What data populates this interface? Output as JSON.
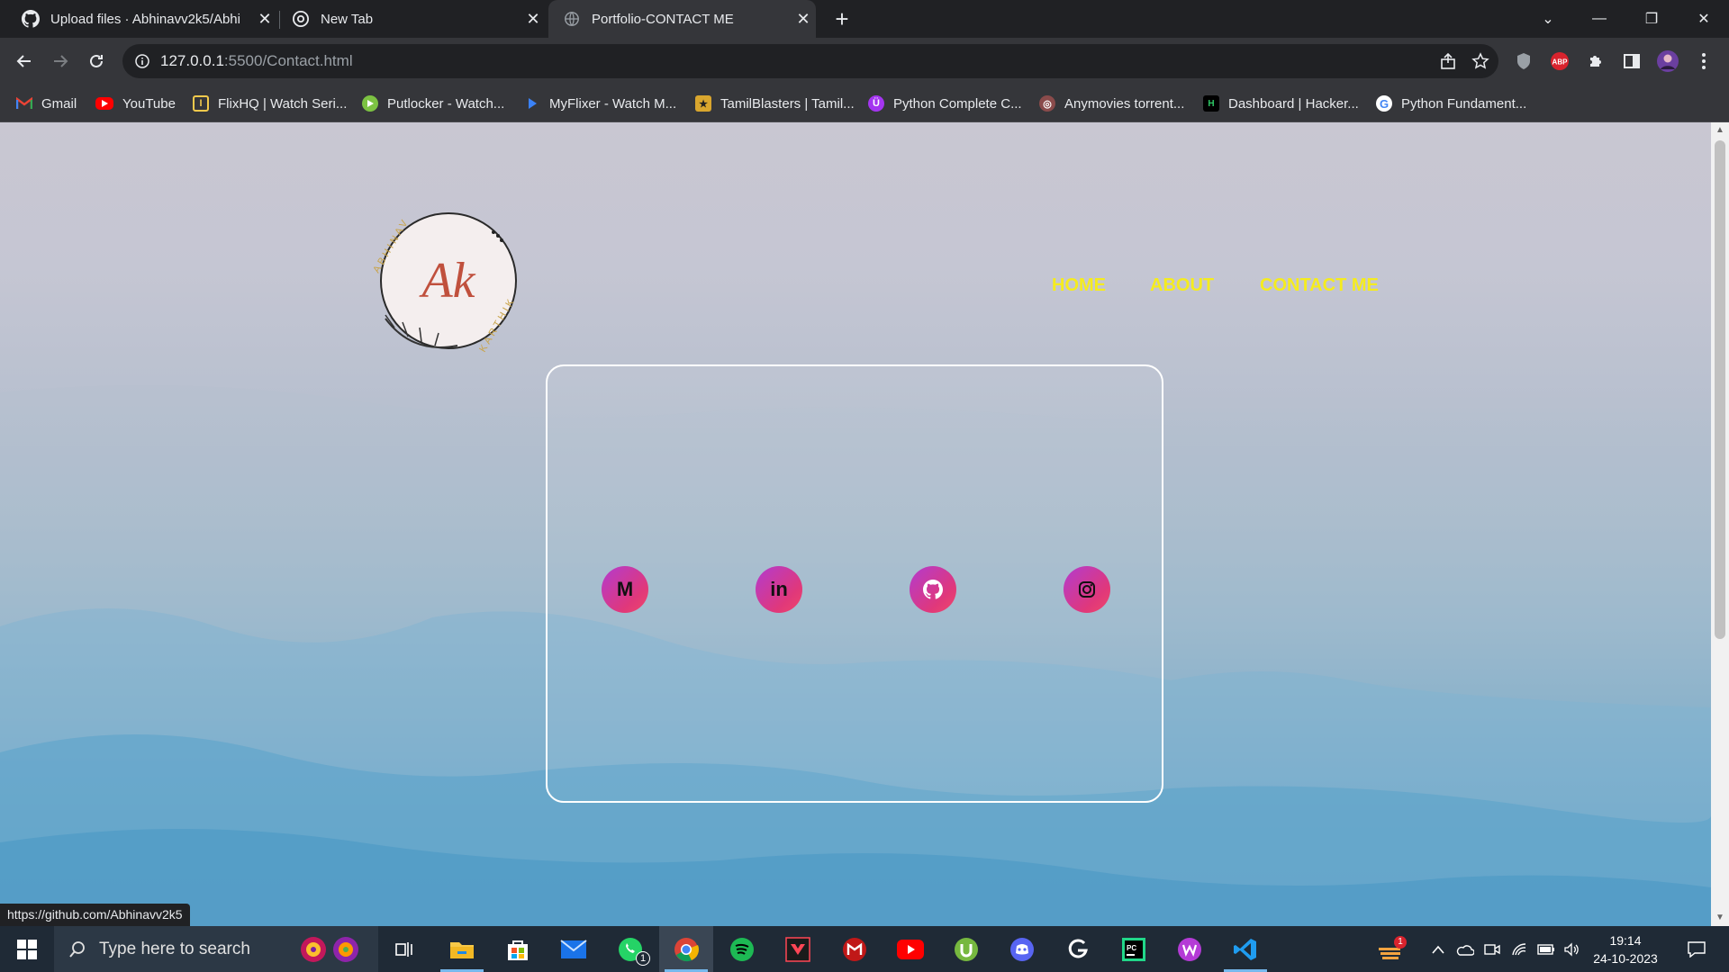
{
  "browser": {
    "tabs": [
      {
        "title": "Upload files · Abhinavv2k5/Abhi",
        "icon": "github-icon",
        "active": false
      },
      {
        "title": "New Tab",
        "icon": "chrome-icon",
        "active": false
      },
      {
        "title": "Portfolio-CONTACT ME",
        "icon": "globe-icon",
        "active": true
      }
    ],
    "new_tab_label": "+",
    "url_host": "127.0.0.1",
    "url_path": ":5500/Contact.html",
    "bookmarks": [
      {
        "label": "Gmail",
        "icon": "gmail-icon"
      },
      {
        "label": "YouTube",
        "icon": "youtube-icon"
      },
      {
        "label": "FlixHQ | Watch Seri...",
        "icon": "flixhq-icon"
      },
      {
        "label": "Putlocker - Watch...",
        "icon": "putlocker-icon"
      },
      {
        "label": "MyFlixer - Watch M...",
        "icon": "myflixer-icon"
      },
      {
        "label": "TamilBlasters | Tamil...",
        "icon": "tamilblasters-icon"
      },
      {
        "label": "Python Complete C...",
        "icon": "udemy-icon"
      },
      {
        "label": "Anymovies torrent...",
        "icon": "anymovies-icon"
      },
      {
        "label": "Dashboard | Hacker...",
        "icon": "hackerrank-icon"
      },
      {
        "label": "Python Fundament...",
        "icon": "google-icon"
      }
    ],
    "status_url": "https://github.com/Abhinavv2k5"
  },
  "page": {
    "logo_text": "Ak",
    "logo_ring_top": "ABHINAV",
    "logo_ring_bottom": "KARTHIK",
    "nav": [
      "HOME",
      "ABOUT",
      "CONTACT ME"
    ],
    "socials": [
      {
        "name": "gmail",
        "glyph": "M"
      },
      {
        "name": "linkedin",
        "glyph": "in"
      },
      {
        "name": "github",
        "glyph": ""
      },
      {
        "name": "instagram",
        "glyph": ""
      }
    ],
    "colors": {
      "nav": "#f5ec1e",
      "social_gradient_start": "#b23bd0",
      "social_gradient_end": "#f0476a"
    }
  },
  "taskbar": {
    "search_placeholder": "Type here to search",
    "time": "19:14",
    "date": "24-10-2023",
    "whatsapp_badge": "1",
    "weather_badge": "1"
  }
}
